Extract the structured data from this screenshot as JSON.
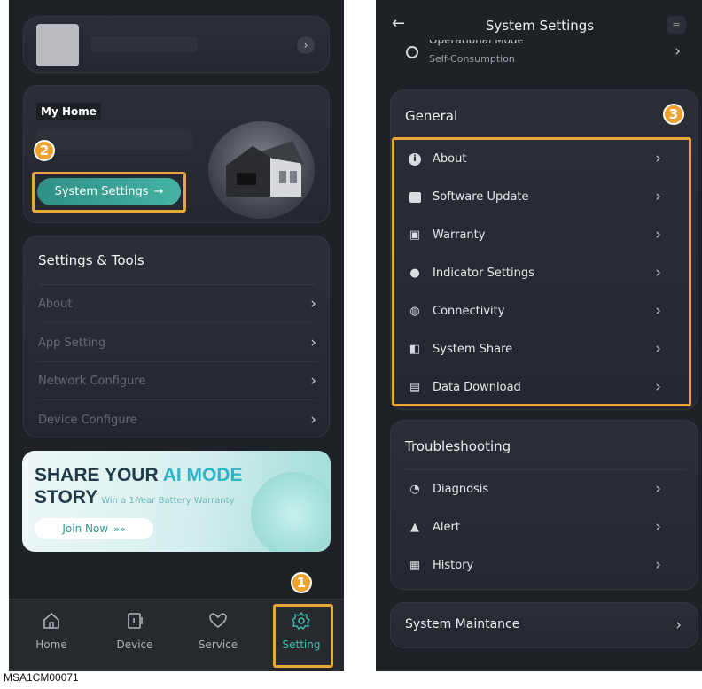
{
  "left": {
    "my_home": {
      "title": "My Home",
      "settings_button": "System Settings"
    },
    "settings_tools": {
      "title": "Settings & Tools",
      "items": [
        {
          "label": "About"
        },
        {
          "label": "App Setting"
        },
        {
          "label": "Network Configure"
        },
        {
          "label": "Device Configure"
        }
      ]
    },
    "banner": {
      "line1a": "SHARE YOUR ",
      "line1b": "AI MODE",
      "line2": "STORY",
      "subtitle": "Win a 1-Year Battery Warranty",
      "cta": "Join Now",
      "cta_arrows": "»»"
    },
    "tabbar": [
      {
        "label": "Home",
        "icon": "home-icon"
      },
      {
        "label": "Device",
        "icon": "device-icon"
      },
      {
        "label": "Service",
        "icon": "service-icon"
      },
      {
        "label": "Setting",
        "icon": "gear-icon",
        "active": true
      }
    ]
  },
  "right": {
    "header": {
      "title": "System Settings"
    },
    "operational": {
      "label": "Operational Mode",
      "value": "Self-Consumption"
    },
    "general": {
      "title": "General",
      "items": [
        {
          "label": "About",
          "icon": "info-icon"
        },
        {
          "label": "Software Update",
          "icon": "update-icon"
        },
        {
          "label": "Warranty",
          "icon": "warranty-icon"
        },
        {
          "label": "Indicator Settings",
          "icon": "indicator-icon"
        },
        {
          "label": "Connectivity",
          "icon": "connectivity-icon"
        },
        {
          "label": "System Share",
          "icon": "share-icon"
        },
        {
          "label": "Data Download",
          "icon": "download-icon"
        }
      ]
    },
    "troubleshooting": {
      "title": "Troubleshooting",
      "items": [
        {
          "label": "Diagnosis",
          "icon": "diagnosis-icon"
        },
        {
          "label": "Alert",
          "icon": "alert-icon"
        },
        {
          "label": "History",
          "icon": "history-icon"
        }
      ]
    },
    "maintenance": {
      "label": "System Maintance"
    }
  },
  "callouts": {
    "one": "1",
    "two": "2",
    "three": "3"
  },
  "figure_code": "MSA1CM00071",
  "colors": {
    "accent_orange": "#f0a22e",
    "teal": "#3aa597",
    "bg": "#1e2126"
  }
}
